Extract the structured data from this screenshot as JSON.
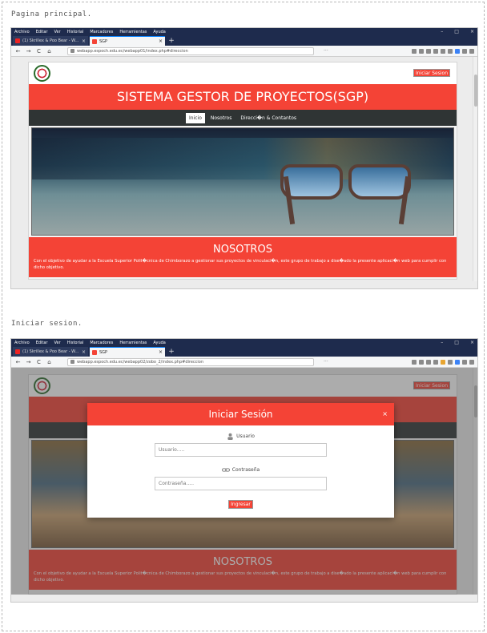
{
  "captions": {
    "top": "Pagina principal.",
    "bottom": "Iniciar sesion."
  },
  "browser": {
    "menu": [
      "Archivo",
      "Editar",
      "Ver",
      "Historial",
      "Marcadores",
      "Herramientas",
      "Ayuda"
    ],
    "tab1_title": "(1) Skrillex & Poo Bear - W...",
    "tab2_title": "SGP",
    "tab_close": "×",
    "new_tab": "+",
    "nav_back": "←",
    "nav_forward": "→",
    "nav_reload": "C",
    "nav_home": "⌂",
    "url_top": "webapp.espoch.edu.ec/webapp01/index.php#direccion",
    "url_bottom": "webapp.espoch.edu.ec/webapp02/zobo_2/index.php#direccion",
    "url_menu": "···",
    "min": "–",
    "max": "□",
    "close": "×",
    "colors": {
      "chrome": "#1e2b4d",
      "active_tab_border": "#0a84ff"
    }
  },
  "site": {
    "login_button": "Iniciar Sesion",
    "banner_title": "SISTEMA GESTOR DE PROYECTOS(SGP)",
    "nav": [
      "Inicio",
      "Nosotros",
      "Direcci�n & Contantos"
    ],
    "about_title": "NOSOTROS",
    "about_text": "Con el objetivo de ayudar a la Escuela Superior Polit�cnica de Chimborazo a gestionar sus proyectos de vinculaci�n, este grupo de trabajo a dise�ado la presente aplicaci�n web para cumplir con dicho objetivo.",
    "colors": {
      "primary": "#f44336",
      "nav_bg": "#2f3434"
    }
  },
  "modal": {
    "title": "Iniciar Sesión",
    "close": "×",
    "user_label": "Usuario",
    "user_icon": "user-icon",
    "user_placeholder": "Usuario.....",
    "password_label": "Contraseña",
    "password_icon": "link-icon",
    "password_placeholder": "Contraseña.....",
    "submit": "Ingresar"
  }
}
